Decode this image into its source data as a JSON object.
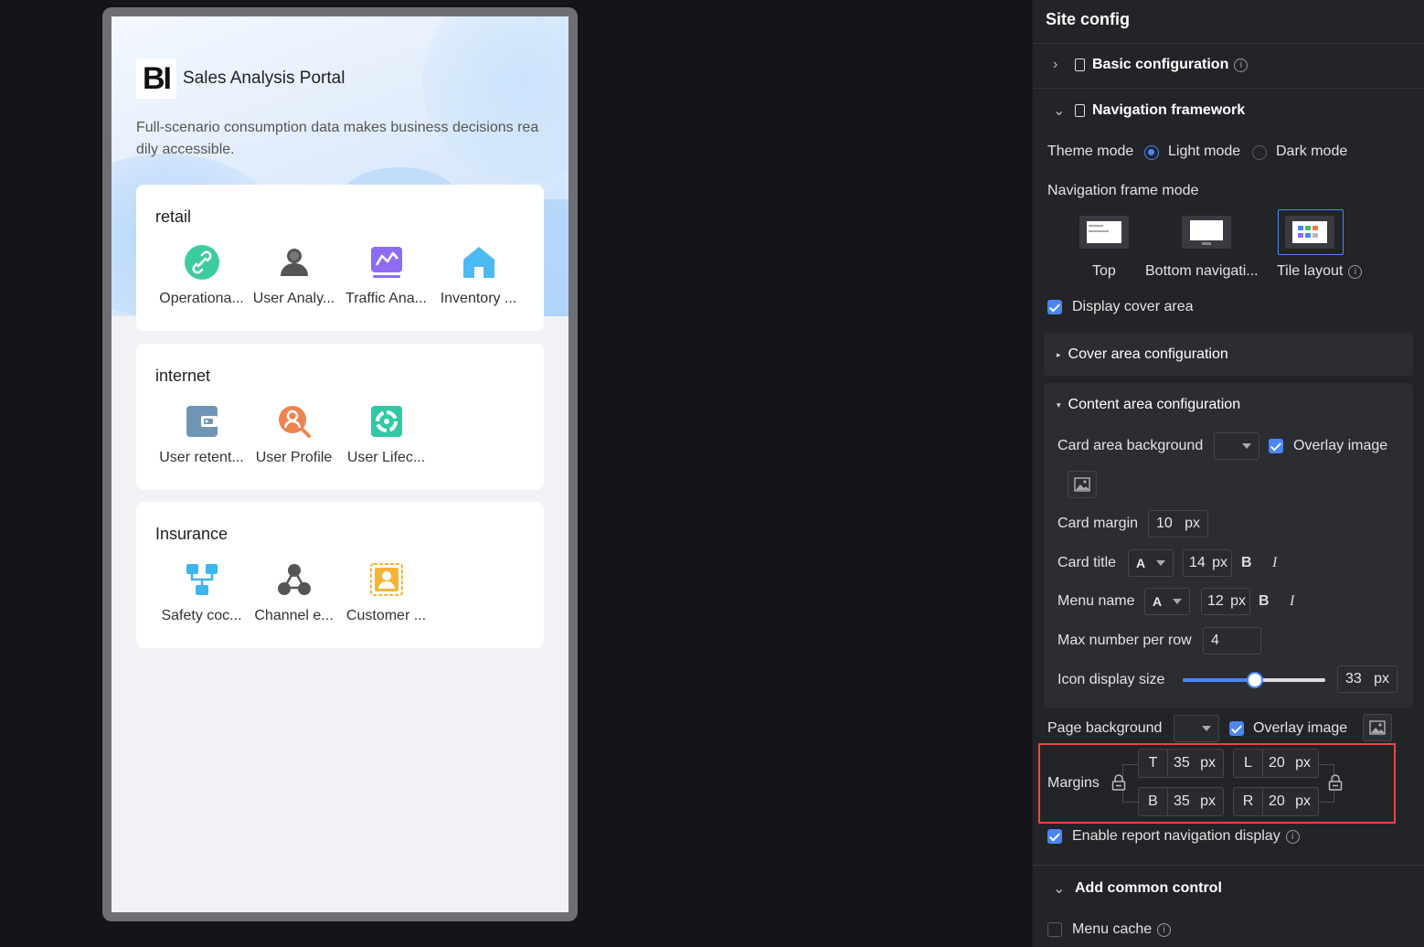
{
  "portal": {
    "logo": "BI",
    "title": "Sales Analysis Portal",
    "subtitle": "Full-scenario consumption data makes business decisions readily accessible."
  },
  "cards": [
    {
      "title": "retail",
      "items": [
        {
          "label": "Operationa...",
          "icon": "link-icon",
          "color": "#3dcca0"
        },
        {
          "label": "User Analy...",
          "icon": "user-group-icon",
          "color": "#555555"
        },
        {
          "label": "Traffic Ana...",
          "icon": "line-chart-monitor-icon",
          "color": "#8d6cf3"
        },
        {
          "label": "Inventory ...",
          "icon": "home-icon",
          "color": "#4cb9f2"
        }
      ]
    },
    {
      "title": "internet",
      "items": [
        {
          "label": "User retent...",
          "icon": "wallet-icon",
          "color": "#6e95b5"
        },
        {
          "label": "User Profile",
          "icon": "user-search-icon",
          "color": "#ee8450"
        },
        {
          "label": "User Lifec...",
          "icon": "lifecycle-icon",
          "color": "#30c9a6"
        }
      ]
    },
    {
      "title": "Insurance",
      "items": [
        {
          "label": "Safety coc...",
          "icon": "flow-icon",
          "color": "#3db6ee"
        },
        {
          "label": "Channel e...",
          "icon": "network-icon",
          "color": "#555555"
        },
        {
          "label": "Customer ...",
          "icon": "customer-badge-icon",
          "color": "#f6b437"
        }
      ]
    }
  ],
  "panel": {
    "title": "Site config",
    "basic": "Basic configuration",
    "nav_framework": "Navigation framework",
    "theme_mode": {
      "label": "Theme mode",
      "light": "Light mode",
      "dark": "Dark mode",
      "selected": "light"
    },
    "nav_frame_mode": {
      "label": "Navigation frame mode",
      "options": [
        "Top",
        "Bottom navigati...",
        "Tile layout"
      ],
      "selected": "Tile layout"
    },
    "display_cover": "Display cover area",
    "cover_config": "Cover area configuration",
    "content_config": "Content area configuration",
    "card_area_bg": "Card area background",
    "overlay_image": "Overlay image",
    "card_margin": {
      "label": "Card margin",
      "value": "10",
      "unit": "px"
    },
    "card_title": {
      "label": "Card title",
      "font": "A",
      "size": "14",
      "unit": "px",
      "bold": "B",
      "italic": "I"
    },
    "menu_name": {
      "label": "Menu name",
      "font": "A",
      "size": "12",
      "unit": "px",
      "bold": "B",
      "italic": "I"
    },
    "max_per_row": {
      "label": "Max number per row",
      "value": "4"
    },
    "icon_size": {
      "label": "Icon display size",
      "value": "33",
      "unit": "px",
      "slider_fraction": 0.5
    },
    "page_bg": "Page background",
    "margins": {
      "label": "Margins",
      "T": "35",
      "B": "35",
      "L": "20",
      "R": "20",
      "unit": "px",
      "kT": "T",
      "kB": "B",
      "kL": "L",
      "kR": "R"
    },
    "enable_report_nav": "Enable report navigation display",
    "add_common_control": "Add common control",
    "menu_cache": "Menu cache"
  },
  "colors": {
    "accent": "#4a86f5",
    "highlight": "#e5493f",
    "panel_bg": "#232428"
  }
}
